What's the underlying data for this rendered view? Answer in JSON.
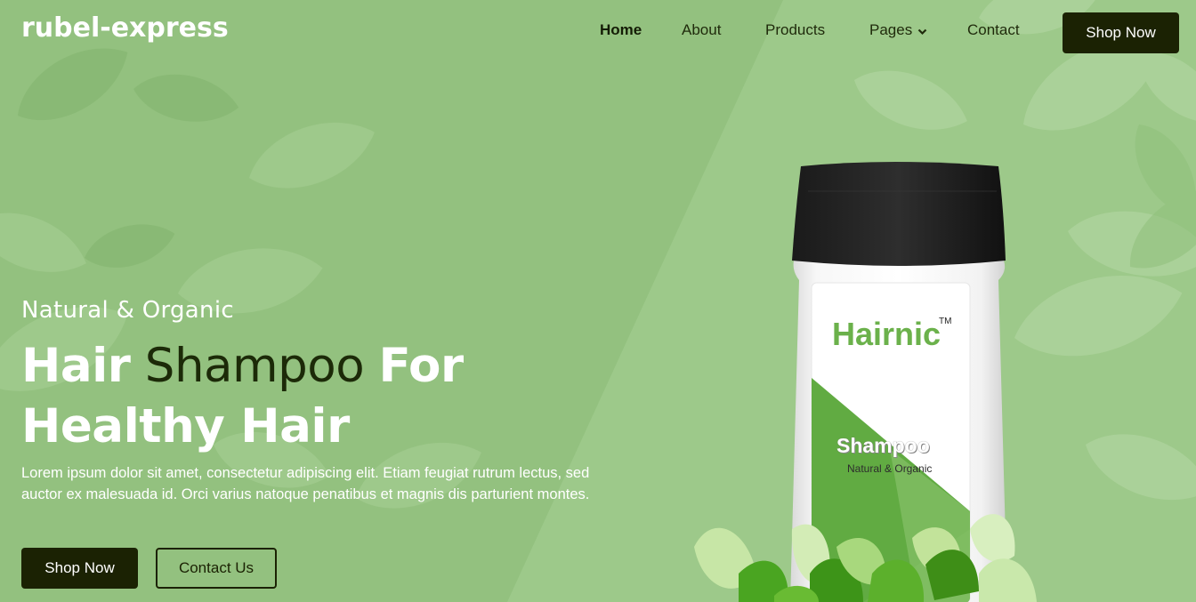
{
  "brand": {
    "logo": "rubel-express"
  },
  "nav": {
    "items": [
      {
        "label": "Home",
        "active": true
      },
      {
        "label": "About"
      },
      {
        "label": "Products"
      },
      {
        "label": "Pages",
        "icon": "chevron-down-icon"
      },
      {
        "label": "Contact"
      }
    ],
    "cta_label": "Shop Now"
  },
  "hero": {
    "eyebrow": "Natural & Organic",
    "headline": {
      "part1": "Hair",
      "part2": "Shampoo",
      "part3": "For",
      "part4": "Healthy Hair"
    },
    "description": "Lorem ipsum dolor sit amet, consectetur adipiscing elit. Etiam feugiat rutrum lectus, sed auctor ex malesuada id. Orci varius natoque penatibus et magnis dis parturient montes.",
    "primary_button": "Shop Now",
    "secondary_button": "Contact Us"
  },
  "product": {
    "brand": "Hairnic",
    "trademark": "TM",
    "name": "Shampoo",
    "tagline": "Natural & Organic"
  },
  "colors": {
    "background": "#93c17f",
    "dark_button": "#1b2203",
    "brand_green": "#6bb14b"
  }
}
